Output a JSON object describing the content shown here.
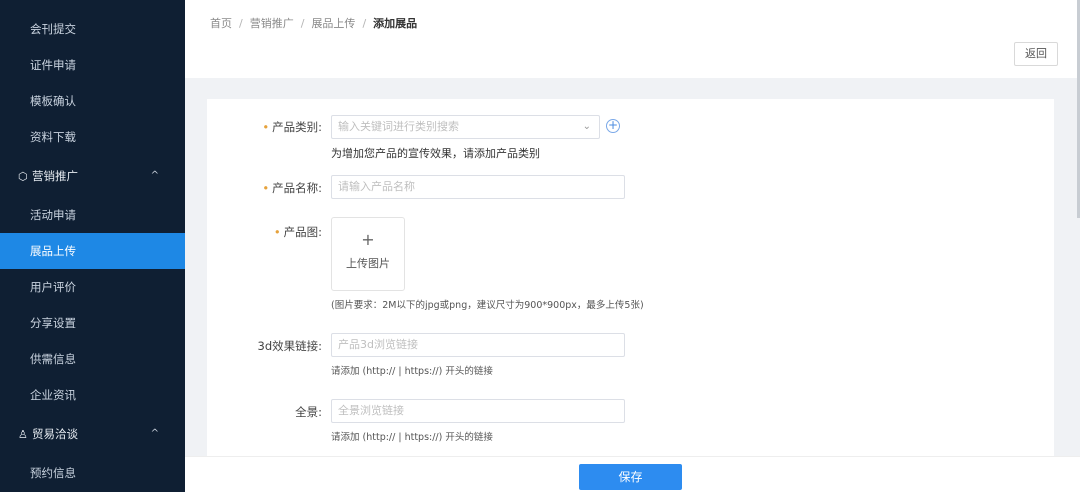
{
  "sidebar": {
    "items_top": [
      "会刊提交",
      "证件申请",
      "模板确认",
      "资料下载"
    ],
    "group_marketing": {
      "label": "营销推广",
      "icon": "cube-icon",
      "chevron": "^"
    },
    "marketing_items": [
      "活动申请",
      "展品上传",
      "用户评价",
      "分享设置",
      "供需信息",
      "企业资讯"
    ],
    "active_item": "展品上传",
    "group_trade": {
      "label": "贸易洽谈",
      "icon": "user-icon",
      "chevron": "^"
    },
    "trade_items": [
      "预约信息"
    ]
  },
  "header": {
    "breadcrumb": [
      "首页",
      "营销推广",
      "展品上传",
      "添加展品"
    ],
    "separator": "/",
    "back_label": "返回"
  },
  "form": {
    "category": {
      "required_mark": "•",
      "label": "产品类别:",
      "placeholder": "输入关键词进行类别搜索",
      "hint": "为增加您产品的宣传效果，请添加产品类别",
      "add_symbol": "+"
    },
    "name": {
      "required_mark": "•",
      "label": "产品名称:",
      "placeholder": "请输入产品名称"
    },
    "image": {
      "required_mark": "•",
      "label": "产品图:",
      "upload_plus": "+",
      "upload_label": "上传图片",
      "hint": "(图片要求：2M以下的jpg或png，建议尺寸为900*900px，最多上传5张)"
    },
    "link3d": {
      "label": "3d效果链接:",
      "placeholder": "产品3d浏览链接",
      "hint": "请添加 (http:// | https://) 开头的链接"
    },
    "panorama": {
      "label": "全景:",
      "placeholder": "全景浏览链接",
      "hint": "请添加 (http:// | https://) 开头的链接"
    }
  },
  "footer": {
    "save_label": "保存"
  },
  "colors": {
    "sidebar_bg": "#0f1f33",
    "accent": "#1e88e5",
    "save_bg": "#2d8cf0",
    "required": "#e6a23c"
  }
}
